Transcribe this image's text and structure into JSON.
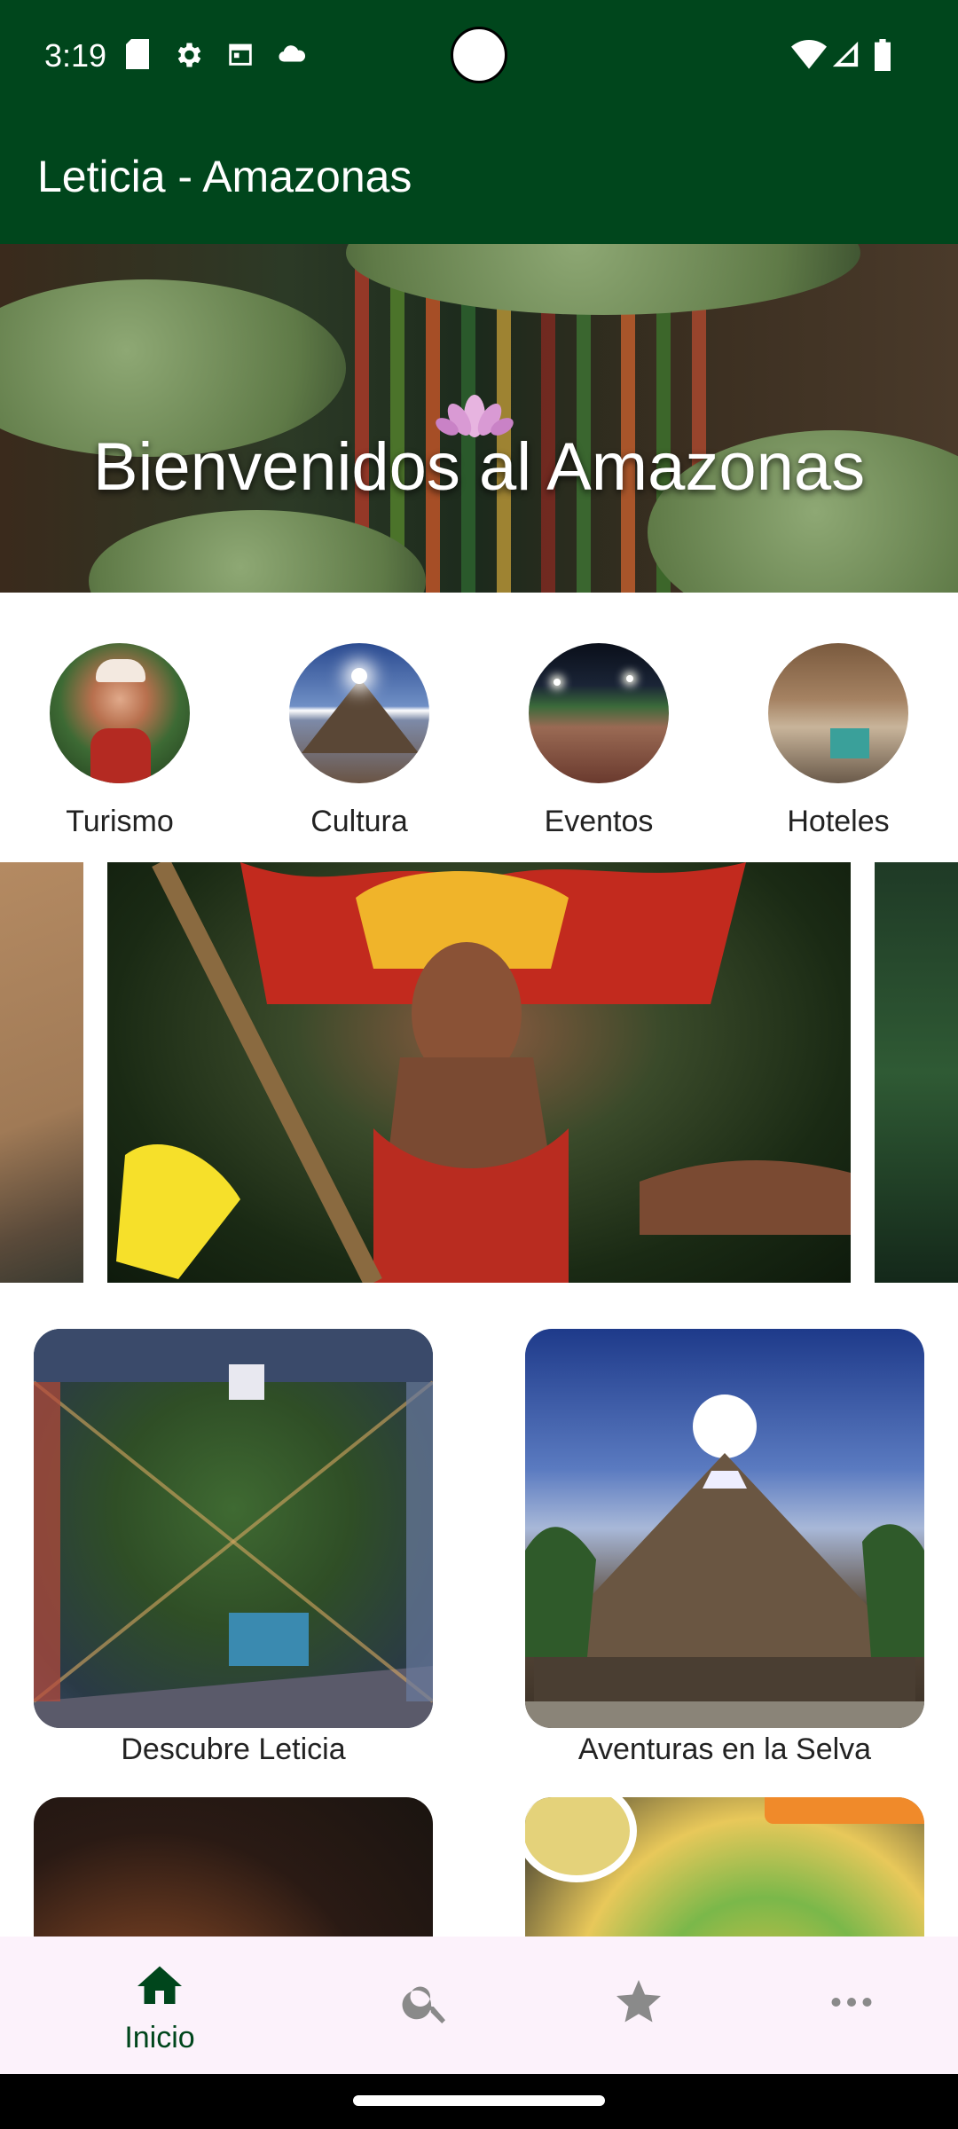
{
  "status_bar": {
    "time": "3:19"
  },
  "app_bar": {
    "title": "Leticia - Amazonas"
  },
  "hero": {
    "title": "Bienvenidos al Amazonas"
  },
  "categories": [
    {
      "label": "Turismo"
    },
    {
      "label": "Cultura"
    },
    {
      "label": "Eventos"
    },
    {
      "label": "Hoteles"
    }
  ],
  "cards": [
    {
      "label": "Descubre Leticia"
    },
    {
      "label": "Aventuras en la Selva"
    }
  ],
  "bottom_nav": {
    "items": [
      {
        "icon": "home-icon",
        "label": "Inicio",
        "selected": true
      },
      {
        "icon": "search-icon",
        "label": "",
        "selected": false
      },
      {
        "icon": "star-icon",
        "label": "",
        "selected": false
      },
      {
        "icon": "more-horizontal-icon",
        "label": "",
        "selected": false
      }
    ]
  },
  "colors": {
    "primary": "#00461c",
    "nav_background": "#fcf2fb"
  }
}
